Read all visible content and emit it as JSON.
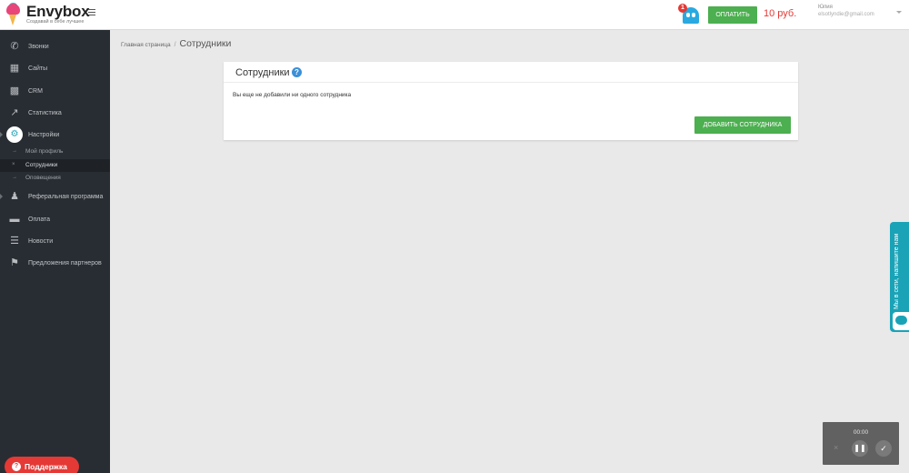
{
  "header": {
    "logo_name": "Envybox",
    "logo_slogan": "Создавай в себе лучшее",
    "notification_count": "1",
    "pay_button": "ОПЛАТИТЬ",
    "balance": "10 руб.",
    "user_name": "Юлия",
    "user_email": "elsotlyndie@gmail.com"
  },
  "sidebar": {
    "items": [
      {
        "label": "Звонки",
        "icon": "phone-icon"
      },
      {
        "label": "Сайты",
        "icon": "grid-icon"
      },
      {
        "label": "CRM",
        "icon": "sitemap-icon"
      },
      {
        "label": "Статистика",
        "icon": "trend-icon"
      },
      {
        "label": "Настройки",
        "icon": "gear-icon"
      },
      {
        "label": "Реферальная программа",
        "icon": "users-icon"
      },
      {
        "label": "Оплата",
        "icon": "card-icon"
      },
      {
        "label": "Новости",
        "icon": "list-icon"
      },
      {
        "label": "Предложения партнеров",
        "icon": "tag-icon"
      }
    ],
    "settings_sub": [
      {
        "label": "Мой профиль",
        "mark": "→"
      },
      {
        "label": "Сотрудники",
        "mark": "×"
      },
      {
        "label": "Оповещения",
        "mark": "→"
      }
    ],
    "support_button": "Поддержка"
  },
  "breadcrumb": {
    "home": "Главная страница",
    "separator": "/",
    "current": "Сотрудники"
  },
  "card": {
    "title": "Сотрудники",
    "help": "?",
    "empty_text": "Вы еще не добавили ни одного сотрудника",
    "add_button": "ДОБАВИТЬ СОТРУДНИКА"
  },
  "chat_tab": {
    "label": "Мы в сети, напишите нам"
  },
  "recorder": {
    "time": "00:00",
    "cancel": "×",
    "pause": "❚❚",
    "done": "✓"
  },
  "colors": {
    "sidebar_bg": "#282d33",
    "accent_green": "#4caf50",
    "accent_red": "#e53935",
    "accent_teal": "#1aa3b7"
  }
}
